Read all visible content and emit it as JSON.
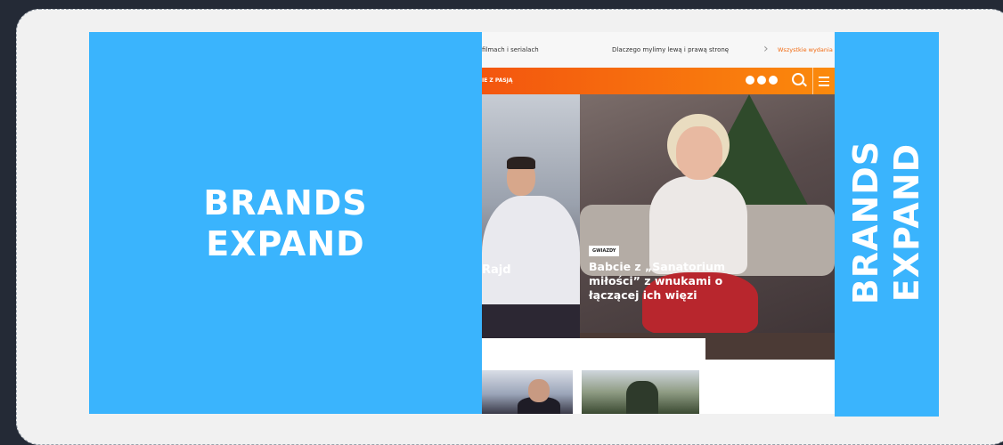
{
  "brand": {
    "left_line1": "BRANDS",
    "left_line2": "EXPAND",
    "right_line1": "BRANDS",
    "right_line2": "EXPAND",
    "color": "#3ab4fd"
  },
  "site": {
    "topbar": {
      "left_text": "filmach i serialach",
      "center_text": "Dlaczego mylimy lewą i prawą stronę",
      "right_link": "Wszystkie wydania"
    },
    "navbar": {
      "label": "IE Z PASJĄ",
      "social_icons": [
        "facebook-icon",
        "instagram-icon",
        "twitter-icon"
      ],
      "accent": "#f3560f"
    },
    "hero_left_caption": "Rajd",
    "hero_right": {
      "badge": "GWIAZDY",
      "headline": "Babcie z „Sanatorium miłości” z wnukami o łączącej ich więzi"
    }
  }
}
